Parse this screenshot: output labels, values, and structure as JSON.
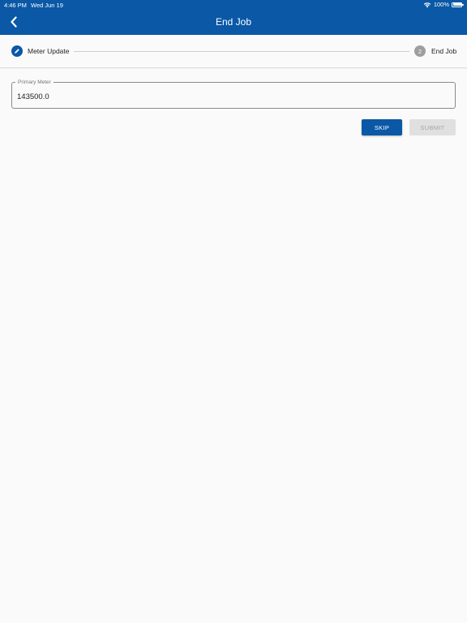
{
  "status_bar": {
    "time": "4:46 PM",
    "date": "Wed Jun 19",
    "battery": "100%"
  },
  "header": {
    "title": "End Job",
    "back_icon": "chevron-left-icon"
  },
  "stepper": {
    "steps": [
      {
        "label": "Meter Update",
        "state": "active",
        "icon": "pencil-icon"
      },
      {
        "label": "End Job",
        "state": "pending",
        "number": "2"
      }
    ]
  },
  "form": {
    "primary_meter": {
      "label": "Primary Meter",
      "value": "143500.0"
    }
  },
  "actions": {
    "skip_label": "SKIP",
    "submit_label": "SUBMIT"
  },
  "colors": {
    "primary": "#0a58a6",
    "disabled_bg": "#e0e0e0",
    "disabled_text": "#a6a6a6",
    "pending_step": "#9e9e9e",
    "background": "#fafafa"
  }
}
